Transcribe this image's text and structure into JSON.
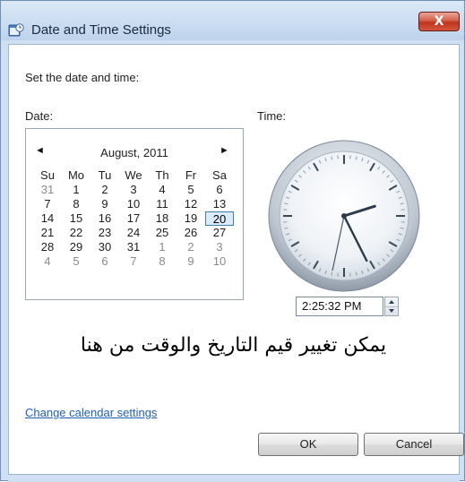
{
  "window": {
    "title": "Date and Time Settings",
    "close_label": "X"
  },
  "content": {
    "instruction": "Set the date and time:",
    "date_label": "Date:",
    "time_label": "Time:"
  },
  "calendar": {
    "prev": "◄",
    "next": "►",
    "month_title": "August, 2011",
    "day_headers": [
      "Su",
      "Mo",
      "Tu",
      "We",
      "Th",
      "Fr",
      "Sa"
    ],
    "weeks": [
      [
        "31",
        "1",
        "2",
        "3",
        "4",
        "5",
        "6"
      ],
      [
        "7",
        "8",
        "9",
        "10",
        "11",
        "12",
        "13"
      ],
      [
        "14",
        "15",
        "16",
        "17",
        "18",
        "19",
        "20"
      ],
      [
        "21",
        "22",
        "23",
        "24",
        "25",
        "26",
        "27"
      ],
      [
        "28",
        "29",
        "30",
        "31",
        "1",
        "2",
        "3"
      ],
      [
        "4",
        "5",
        "6",
        "7",
        "8",
        "9",
        "10"
      ]
    ],
    "selected_day": "20"
  },
  "clock": {
    "hours": 2,
    "minutes": 25,
    "seconds": 32
  },
  "time": {
    "value": "2:25:32 PM"
  },
  "annotation": {
    "text": "يمكن تغيير قيم التاريخ والوقت من هنا"
  },
  "links": {
    "change_calendar": "Change calendar settings"
  },
  "buttons": {
    "ok": "OK",
    "cancel": "Cancel"
  },
  "colors": {
    "accent": "#1f5fb8",
    "selection": "#3c7fb1",
    "close": "#c0341f"
  }
}
